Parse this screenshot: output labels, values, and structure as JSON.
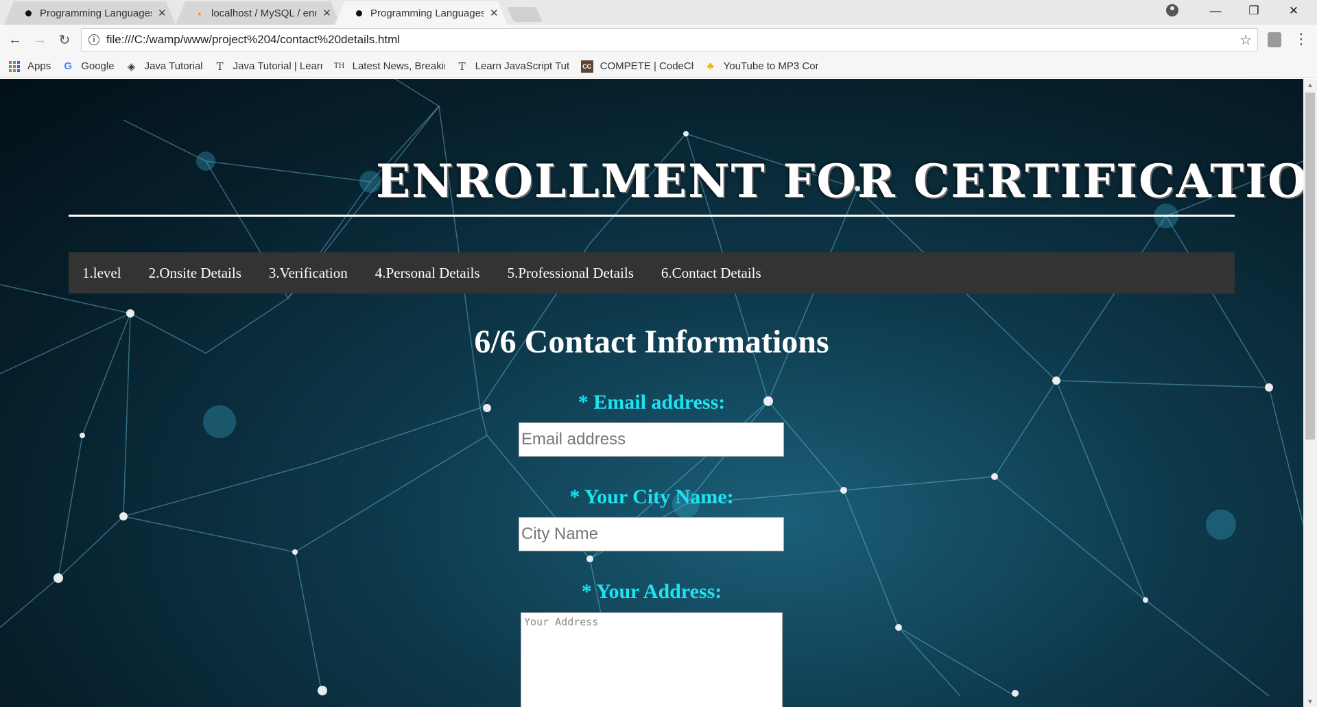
{
  "browser": {
    "tabs": [
      {
        "title": "Programming Languages",
        "favicon": "black-dot-icon",
        "active": false
      },
      {
        "title": "localhost / MySQL / enro",
        "favicon": "phpmyadmin-icon",
        "active": false
      },
      {
        "title": "Programming Languages",
        "favicon": "black-dot-icon",
        "active": true
      }
    ],
    "tab_close_glyph": "✕",
    "url": "file:///C:/wamp/www/project%204/contact%20details.html",
    "bookmarks": [
      {
        "label": "Apps",
        "icon": "apps-grid-icon"
      },
      {
        "label": "Google",
        "icon": "google-icon"
      },
      {
        "label": "Java Tutorial",
        "icon": "java-tutorial-icon"
      },
      {
        "label": "Java Tutorial | Learn",
        "icon": "t-icon"
      },
      {
        "label": "Latest News, Breakin",
        "icon": "th-icon"
      },
      {
        "label": "Learn JavaScript Tuto",
        "icon": "t-icon"
      },
      {
        "label": "COMPETE | CodeChe",
        "icon": "codechef-icon"
      },
      {
        "label": "YouTube to MP3 Cor",
        "icon": "converter-icon"
      }
    ]
  },
  "page": {
    "banner": "ENROLLMENT FOR CERTIFICATION",
    "nav": [
      "1.level",
      "2.Onsite Details",
      "3.Verification",
      "4.Personal Details",
      "5.Professional Details",
      "6.Contact Details"
    ],
    "form_title": "6/6 Contact Informations",
    "fields": {
      "email": {
        "label": "* Email address:",
        "placeholder": "Email address"
      },
      "city": {
        "label": "* Your City Name:",
        "placeholder": "City Name"
      },
      "address": {
        "label": "* Your Address:",
        "placeholder": "Your Address"
      }
    }
  },
  "colors": {
    "label_cyan": "#1fe3f0",
    "navbar_bg": "#333333",
    "background_teal": "#0e3a4d"
  }
}
